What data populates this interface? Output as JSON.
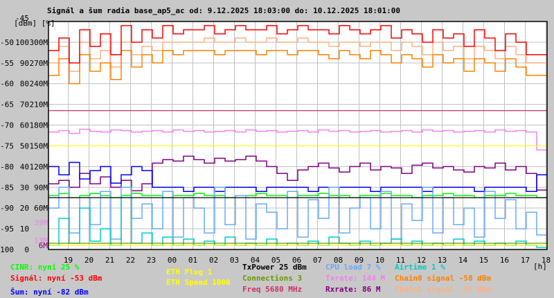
{
  "chart_data": {
    "type": "line",
    "title": "Signál a šum radia base_ap5_ac od: 9.12.2025 18:03:00 do: 10.12.2025 18:01:00",
    "ylabel": "[dBm] [%]",
    "xlabel": "[h]",
    "ylim": [
      -100,
      -45
    ],
    "top_label": "-45",
    "y_ticks": [
      {
        "dbm": "-50",
        "pct": "100",
        "rate": "300M",
        "v": -50
      },
      {
        "dbm": "-55",
        "pct": "90",
        "rate": "270M",
        "v": -55
      },
      {
        "dbm": "-60",
        "pct": "80",
        "rate": "240M",
        "v": -60
      },
      {
        "dbm": "-65",
        "pct": "70",
        "rate": "210M",
        "v": -65
      },
      {
        "dbm": "-70",
        "pct": "60",
        "rate": "180M",
        "v": -70
      },
      {
        "dbm": "-75",
        "pct": "50",
        "rate": "150M",
        "v": -75
      },
      {
        "dbm": "-80",
        "pct": "40",
        "rate": "120M",
        "v": -80
      },
      {
        "dbm": "-85",
        "pct": "30",
        "rate": "90M",
        "v": -85
      },
      {
        "dbm": "-90",
        "pct": "20",
        "rate": "60M",
        "v": -90
      },
      {
        "dbm": "-95",
        "pct": "10",
        "rate": "",
        "v": -95
      },
      {
        "dbm": "-100",
        "pct": "0",
        "rate": "",
        "v": -100
      }
    ],
    "extra_labels": [
      {
        "text": "39M",
        "color": "#ee82ee",
        "v": -93.5
      },
      {
        "text": "13M",
        "color": "#ee82ee",
        "v": -97.8
      },
      {
        "text": "6M",
        "color": "#800080",
        "v": -99
      }
    ],
    "x_ticks": [
      "19",
      "20",
      "21",
      "22",
      "23",
      "00",
      "01",
      "02",
      "03",
      "04",
      "05",
      "06",
      "07",
      "08",
      "09",
      "10",
      "11",
      "12",
      "13",
      "14",
      "15",
      "16",
      "17",
      "18"
    ],
    "x_first_tick_offset_h": 0.95,
    "x_range_h": 24,
    "series": [
      {
        "name": "Chain1 signal",
        "unit": "dBm",
        "color": "#ffb080",
        "values": [
          -55,
          -51,
          -57,
          -50,
          -54,
          -52,
          -56,
          -50,
          -53,
          -51,
          -52,
          -50,
          -50,
          -50,
          -50,
          -49,
          -50,
          -50,
          -49,
          -50,
          -50,
          -49,
          -50,
          -50,
          -49,
          -50,
          -50,
          -51,
          -50,
          -50,
          -51,
          -50,
          -50,
          -52,
          -50,
          -51,
          -53,
          -50,
          -52,
          -51,
          -54,
          -51,
          -52,
          -54,
          -51,
          -53,
          -55,
          -55
        ]
      },
      {
        "name": "Chain0 signal",
        "unit": "dBm",
        "color": "#ff8000",
        "values": [
          -58,
          -54,
          -60,
          -53,
          -57,
          -55,
          -59,
          -52,
          -56,
          -53,
          -55,
          -52,
          -53,
          -52,
          -52,
          -52,
          -53,
          -52,
          -52,
          -52,
          -53,
          -52,
          -52,
          -53,
          -52,
          -52,
          -53,
          -54,
          -52,
          -53,
          -54,
          -52,
          -53,
          -55,
          -53,
          -54,
          -56,
          -53,
          -55,
          -54,
          -57,
          -54,
          -55,
          -57,
          -54,
          -56,
          -58,
          -58
        ]
      },
      {
        "name": "Signál",
        "unit": "dBm",
        "color": "#ff0000",
        "values": [
          -52,
          -49,
          -55,
          -47,
          -51,
          -48,
          -53,
          -46,
          -50,
          -47,
          -49,
          -46,
          -48,
          -47,
          -47,
          -46,
          -48,
          -47,
          -46,
          -47,
          -47,
          -46,
          -48,
          -47,
          -46,
          -47,
          -47,
          -48,
          -46,
          -47,
          -48,
          -47,
          -46,
          -49,
          -47,
          -48,
          -50,
          -47,
          -49,
          -48,
          -51,
          -47,
          -49,
          -52,
          -48,
          -50,
          -53,
          -53
        ]
      },
      {
        "name": "Txrate",
        "unit": "M",
        "color": "#ee82ee",
        "values": [
          170,
          172,
          168,
          174,
          171,
          170,
          173,
          172,
          170,
          171,
          172,
          170,
          173,
          171,
          172,
          170,
          171,
          172,
          170,
          173,
          171,
          172,
          170,
          171,
          172,
          170,
          173,
          171,
          172,
          170,
          171,
          172,
          170,
          171,
          172,
          170,
          173,
          171,
          172,
          170,
          171,
          172,
          170,
          173,
          171,
          172,
          170,
          144
        ]
      },
      {
        "name": "Rxrate",
        "unit": "M",
        "color": "#800080",
        "values": [
          95,
          100,
          90,
          110,
          95,
          105,
          90,
          100,
          85,
          95,
          125,
          130,
          128,
          135,
          130,
          125,
          132,
          128,
          130,
          135,
          128,
          120,
          110,
          100,
          115,
          120,
          125,
          118,
          112,
          120,
          125,
          115,
          120,
          118,
          110,
          122,
          125,
          118,
          120,
          115,
          112,
          120,
          118,
          125,
          115,
          120,
          110,
          86
        ]
      },
      {
        "name": "Šum",
        "unit": "dBm",
        "color": "#0000ff",
        "values": [
          -80,
          -82,
          -79,
          -83,
          -81,
          -80,
          -84,
          -82,
          -80,
          -81,
          -85,
          -85,
          -85,
          -86,
          -85,
          -85,
          -86,
          -85,
          -85,
          -85,
          -86,
          -85,
          -85,
          -85,
          -85,
          -86,
          -85,
          -85,
          -85,
          -85,
          -85,
          -86,
          -85,
          -85,
          -85,
          -85,
          -86,
          -85,
          -85,
          -85,
          -85,
          -86,
          -85,
          -85,
          -85,
          -85,
          -86,
          -82
        ]
      },
      {
        "name": "CINR",
        "unit": "%",
        "color": "#00ff00",
        "values": [
          26,
          27,
          25,
          26,
          27,
          26,
          25,
          26,
          27,
          26,
          26,
          25,
          26,
          26,
          27,
          26,
          26,
          25,
          26,
          26,
          27,
          26,
          26,
          25,
          26,
          26,
          27,
          26,
          26,
          25,
          26,
          26,
          27,
          26,
          26,
          25,
          26,
          26,
          27,
          26,
          26,
          25,
          26,
          26,
          27,
          26,
          26,
          25
        ]
      },
      {
        "name": "CPU load",
        "unit": "%",
        "color": "#66aaff",
        "values": [
          20,
          30,
          8,
          25,
          12,
          28,
          5,
          30,
          15,
          22,
          10,
          28,
          6,
          25,
          20,
          8,
          30,
          12,
          26,
          5,
          22,
          18,
          10,
          28,
          6,
          24,
          15,
          30,
          8,
          20,
          25,
          10,
          28,
          5,
          22,
          14,
          30,
          8,
          25,
          12,
          20,
          6,
          28,
          15,
          24,
          10,
          18,
          7
        ]
      },
      {
        "name": "Airtime",
        "unit": "%",
        "color": "#00cccc",
        "values": [
          2,
          15,
          3,
          20,
          4,
          10,
          2,
          25,
          3,
          8,
          2,
          6,
          2,
          5,
          2,
          4,
          2,
          6,
          2,
          3,
          2,
          5,
          2,
          3,
          2,
          4,
          2,
          6,
          3,
          2,
          4,
          2,
          3,
          5,
          2,
          4,
          2,
          3,
          2,
          5,
          2,
          4,
          2,
          3,
          2,
          4,
          2,
          1
        ]
      }
    ],
    "reference_lines": [
      {
        "name": "Freq",
        "color": "#cc3366",
        "v": -66.5
      },
      {
        "name": "ETH Speed",
        "color": "#ffff00",
        "v": -75
      },
      {
        "name": "TxPower",
        "color": "#000000",
        "v": -87.5
      },
      {
        "name": "Connections",
        "color": "#669900",
        "v": -98.5
      },
      {
        "name": "ETH Plug",
        "color": "#ffff00",
        "v": -99
      }
    ]
  },
  "legend": {
    "cinr": "CINR: nyní 25 %",
    "signal": "Signál: nyní -53 dBm",
    "noise": "Šum: nyní -82 dBm",
    "eth_plug": "ETH Plug 1",
    "eth_speed": "ETH Speed 1000",
    "txpower": "TxPower 25 dBm",
    "connections": "Connections 3",
    "freq": "Freq 5680 MHz",
    "cpu": "CPU load 7 %",
    "txrate": "Txrate: 144 M",
    "rxrate": "Rxrate: 86 M",
    "airtime": "Airtime 1 %",
    "chain0": "Chain0 signal -58 dBm",
    "chain1": "Chain1 signal -55 dBm"
  },
  "colors": {
    "background": "#c8c8c8",
    "plot": "#ffffff",
    "grid": "#c0c0c0"
  }
}
